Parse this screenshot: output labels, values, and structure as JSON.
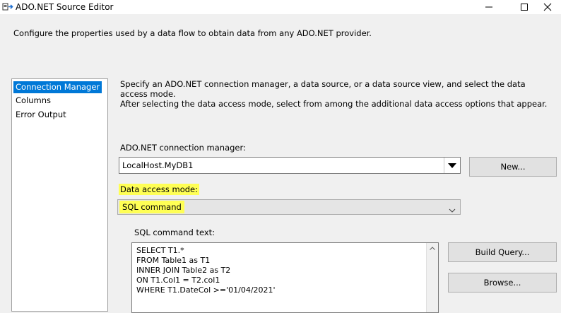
{
  "window": {
    "title": "ADO.NET Source Editor",
    "description": "Configure the properties used by a data flow to obtain data from any ADO.NET provider."
  },
  "nav": {
    "items": [
      {
        "label": "Connection Manager",
        "selected": true
      },
      {
        "label": "Columns",
        "selected": false
      },
      {
        "label": "Error Output",
        "selected": false
      }
    ]
  },
  "main": {
    "instructions_line1": "Specify an ADO.NET connection manager, a data source, or a data source view, and select the data access mode.",
    "instructions_line2": "After selecting the data access mode, select from among the additional data access options that appear.",
    "connection_label": "ADO.NET connection manager:",
    "connection_value": "LocalHost.MyDB1",
    "new_button": "New...",
    "access_mode_label": "Data access mode:",
    "access_mode_value": "SQL command",
    "sql_label": "SQL command text:",
    "sql_lines": [
      "SELECT T1.*",
      "FROM Table1 as T1",
      "INNER JOIN Table2 as T2",
      "ON T1.Col1 = T2.col1",
      "WHERE T1.DateCol >='01/04/2021'"
    ],
    "build_query_button": "Build Query...",
    "browse_button": "Browse..."
  },
  "colors": {
    "selection": "#0078d7",
    "highlight": "#ffff55"
  },
  "icons": {
    "app": "ssis-source-icon",
    "minimize": "minimize-icon",
    "maximize": "maximize-icon",
    "close": "close-icon"
  }
}
